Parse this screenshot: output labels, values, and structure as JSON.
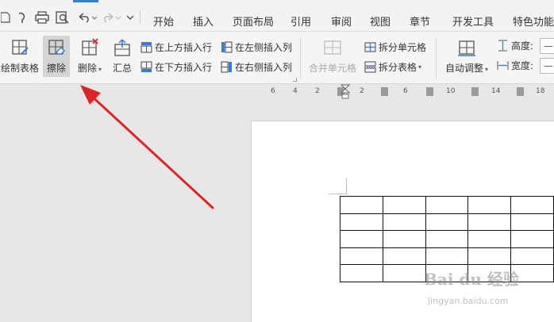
{
  "quick_access": {
    "icons": [
      "open-icon",
      "format-painter-icon",
      "print-icon",
      "print-preview-icon",
      "undo-icon",
      "redo-icon",
      "customize-icon"
    ]
  },
  "menu": {
    "tabs": [
      "开始",
      "插入",
      "页面布局",
      "引用",
      "审阅",
      "视图",
      "章节",
      "开发工具",
      "特色功能"
    ]
  },
  "ribbon": {
    "draw_table": "绘制表格",
    "eraser": "擦除",
    "delete": "删除",
    "summary": "汇总",
    "insert_row_above": "在上方插入行",
    "insert_row_below": "在下方插入行",
    "insert_col_left": "在左侧插入列",
    "insert_col_right": "在右侧插入列",
    "merge_cells": "合并单元格",
    "split_cells": "拆分单元格",
    "split_table": "拆分表格",
    "auto_fit": "自动调整",
    "height_label": "高度:",
    "width_label": "宽度:",
    "height_value": "—",
    "width_value": "—"
  },
  "ruler": {
    "numbers": [
      "6",
      "4",
      "2",
      "2",
      "6",
      "10",
      "14",
      "18"
    ]
  },
  "document": {
    "table": {
      "rows": 5,
      "cols": 5
    }
  },
  "watermark": {
    "brand": "Bai du 经验",
    "url": "jingyan.baidu.com"
  },
  "colors": {
    "accent": "#3a7bd5",
    "annotation_arrow": "#e02424",
    "active_button": "#d4d4d4"
  }
}
